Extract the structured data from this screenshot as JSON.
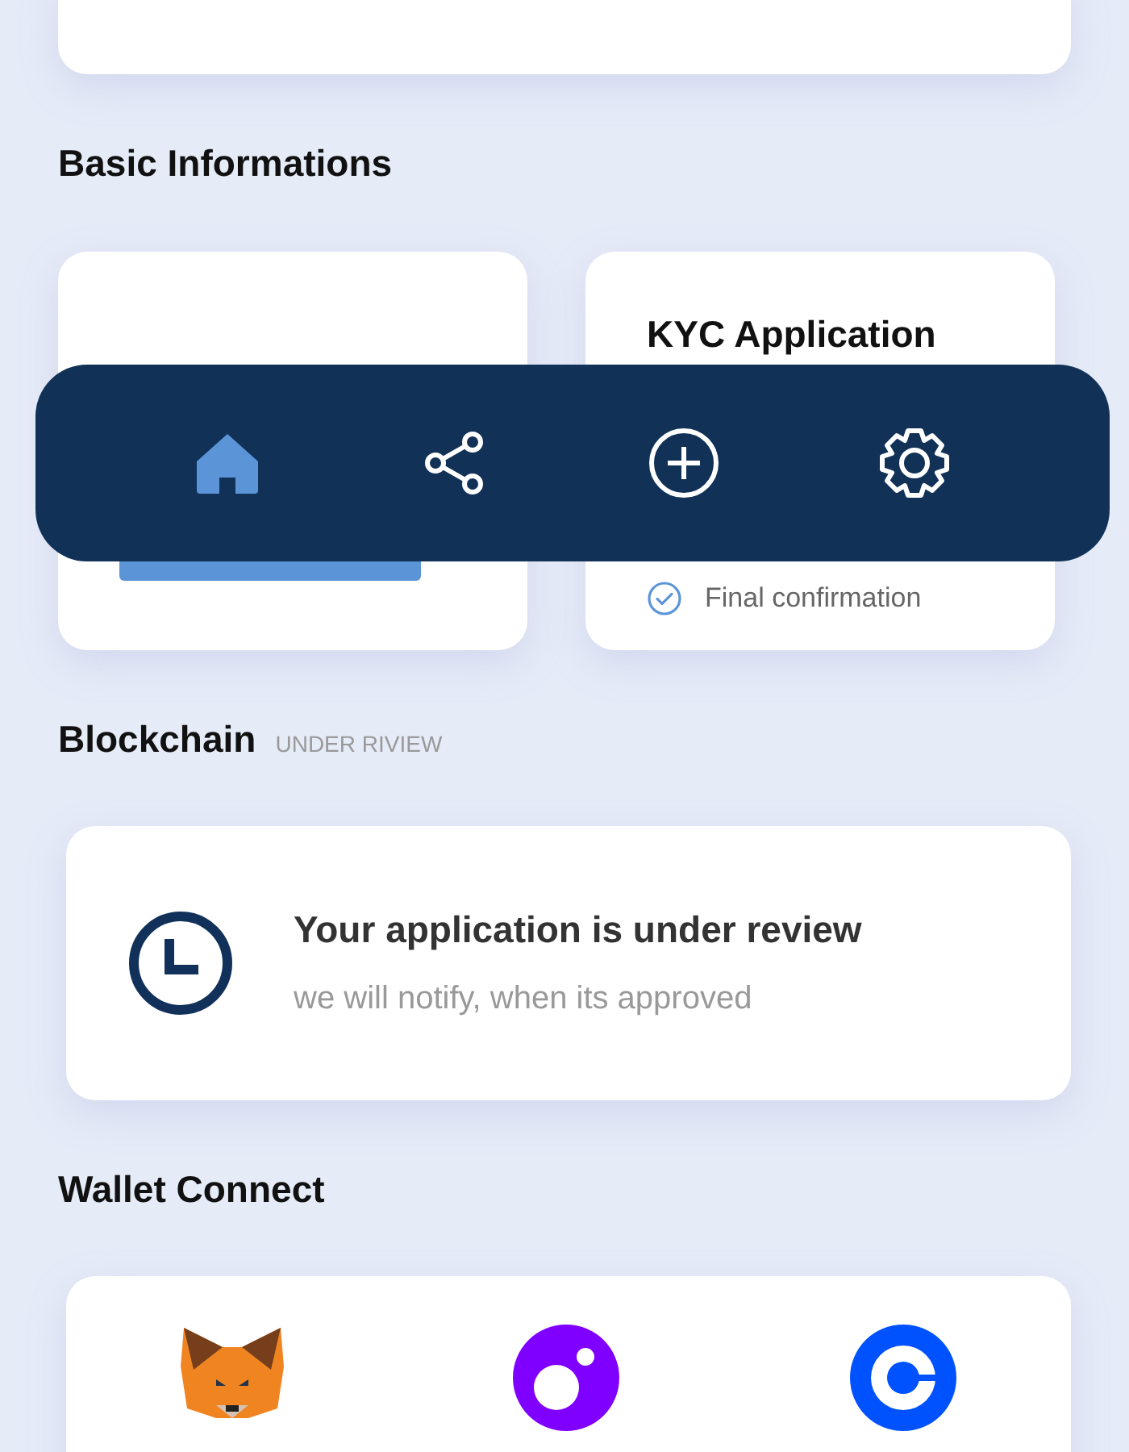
{
  "sections": [
    {
      "title": "Basic Informations"
    }
  ],
  "kyc_card": {
    "title": "KYC Application",
    "steps": [
      {
        "label": "Final confirmation",
        "checked": true
      }
    ]
  },
  "nav": [
    {
      "kind": "home",
      "selected": true
    },
    {
      "kind": "share",
      "selected": false
    },
    {
      "kind": "add",
      "selected": false
    },
    {
      "kind": "settings",
      "selected": false
    }
  ],
  "blockchain": {
    "title": "Blockchain",
    "badge": "UNDER RIVIEW",
    "message": "Your application is under review",
    "note": "we will notify, when its approved"
  },
  "wallet_connect": {
    "title": "Wallet Connect",
    "wallets": [
      {
        "kind": "fox"
      },
      {
        "kind": "orb"
      },
      {
        "kind": "ring"
      }
    ]
  }
}
